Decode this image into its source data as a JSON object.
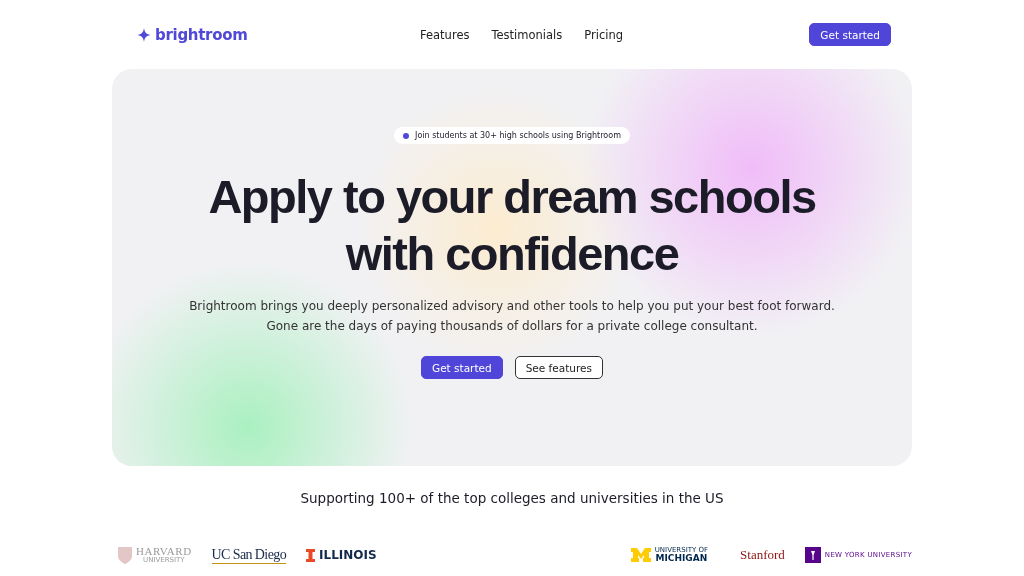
{
  "nav": {
    "brand": "brightroom",
    "links": [
      "Features",
      "Testimonials",
      "Pricing"
    ],
    "cta": "Get started"
  },
  "hero": {
    "badge": "Join students at 30+ high schools using Brightroom",
    "title_lines": [
      "Apply to your dream schools",
      "with confidence"
    ],
    "subtitle": "Brightroom brings you deeply personalized advisory and other tools to help you put your best foot forward. Gone are the days of paying thousands of dollars for a private college consultant.",
    "primary": "Get started",
    "secondary": "See features"
  },
  "schools": {
    "heading": "Supporting 100+ of the top colleges and universities in the US",
    "logos": [
      {
        "kind": "shield",
        "lines": [
          "HARVARD",
          "UNIVERSITY"
        ]
      },
      {
        "kind": "underline",
        "lines": [
          "UC San Diego"
        ]
      },
      {
        "kind": "block-i",
        "lines": [
          "ILLINOIS"
        ]
      },
      {
        "kind": "block-m",
        "lines": [
          "UNIVERSITY OF",
          "MICHIGAN"
        ]
      },
      {
        "kind": "serif",
        "lines": [
          "Stanford"
        ]
      },
      {
        "kind": "torch",
        "lines": [
          "NEW YORK UNIVERSITY"
        ]
      }
    ]
  }
}
